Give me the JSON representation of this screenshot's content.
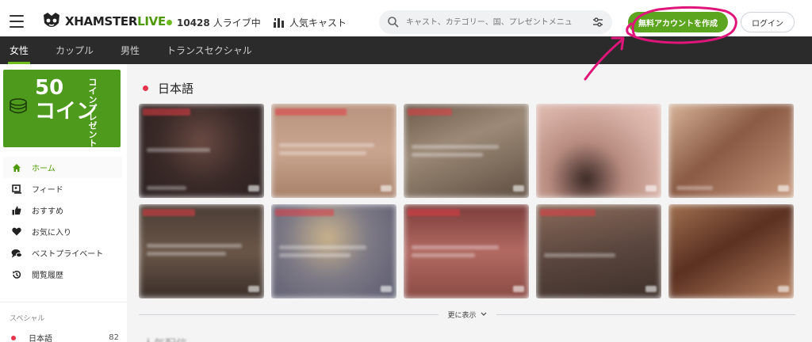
{
  "header": {
    "logo_text": "XHAMSTER",
    "logo_live": "LIVE",
    "live_count": "10428",
    "live_label": "人ライブ中",
    "popular_label": "人気キャスト",
    "search_placeholder": "キャスト、カテゴリー、国、プレゼントメニュ",
    "create_account": "無料アカウントを作成",
    "login": "ログイン"
  },
  "tabs": [
    {
      "label": "女性",
      "active": true
    },
    {
      "label": "カップル",
      "active": false
    },
    {
      "label": "男性",
      "active": false
    },
    {
      "label": "トランスセクシャル",
      "active": false
    }
  ],
  "promo": {
    "amount": "50",
    "unit": "コイン",
    "vertical": "コインプレゼント"
  },
  "menu": [
    {
      "label": "ホーム",
      "icon": "home-icon",
      "active": true
    },
    {
      "label": "フィード",
      "icon": "feed-icon",
      "active": false
    },
    {
      "label": "おすすめ",
      "icon": "thumbs-up-icon",
      "active": false
    },
    {
      "label": "お気に入り",
      "icon": "heart-icon",
      "active": false
    },
    {
      "label": "ベストプライベート",
      "icon": "chat-bubble-icon",
      "active": false
    },
    {
      "label": "閲覧履歴",
      "icon": "history-icon",
      "active": false
    }
  ],
  "special": {
    "heading": "スペシャル",
    "language_label": "日本語",
    "language_count": "82"
  },
  "main": {
    "section_title": "日本語",
    "show_more": "更に表示",
    "next_section_title": "人気配信"
  },
  "colors": {
    "accent": "#5ba51f",
    "live_dot": "#e8344a",
    "annotation": "#e0157a",
    "tabbar": "#2b2b2b"
  }
}
